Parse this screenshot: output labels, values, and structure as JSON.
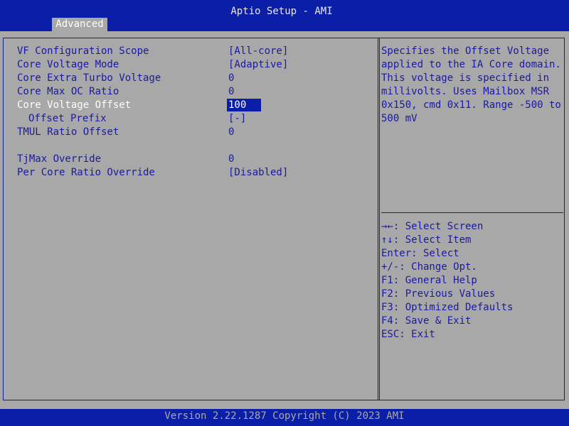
{
  "header": {
    "title": "Aptio Setup - AMI",
    "tab": "Advanced"
  },
  "settings": [
    {
      "label": "VF Configuration Scope",
      "value": "[All-core]"
    },
    {
      "label": "Core Voltage Mode",
      "value": "[Adaptive]"
    },
    {
      "label": "Core Extra Turbo Voltage",
      "value": "0"
    },
    {
      "label": "Core Max OC Ratio",
      "value": "0"
    },
    {
      "label": "Core Voltage Offset",
      "value": "100"
    },
    {
      "label": "Offset Prefix",
      "value": "[-]"
    },
    {
      "label": "TMUL Ratio Offset",
      "value": "0"
    },
    {
      "label": "TjMax Override",
      "value": "0"
    },
    {
      "label": "Per Core Ratio Override",
      "value": "[Disabled]"
    }
  ],
  "help": {
    "text": "Specifies the Offset Voltage\napplied to the IA Core domain.\nThis voltage is specified in\nmillivolts. Uses Mailbox MSR\n0x150, cmd 0x11. Range -500 to\n500 mV"
  },
  "keys": [
    "→←: Select Screen",
    "↑↓: Select Item",
    "Enter: Select",
    "+/-: Change Opt.",
    "F1: General Help",
    "F2: Previous Values",
    "F3: Optimized Defaults",
    "F4: Save & Exit",
    "ESC: Exit"
  ],
  "footer": {
    "text": "Version 2.22.1287 Copyright (C) 2023 AMI"
  },
  "colors": {
    "background": "#a8a8a8",
    "bar": "#0b1ea8",
    "text": "#1a1aa0",
    "highlight_text": "#ffffff"
  }
}
